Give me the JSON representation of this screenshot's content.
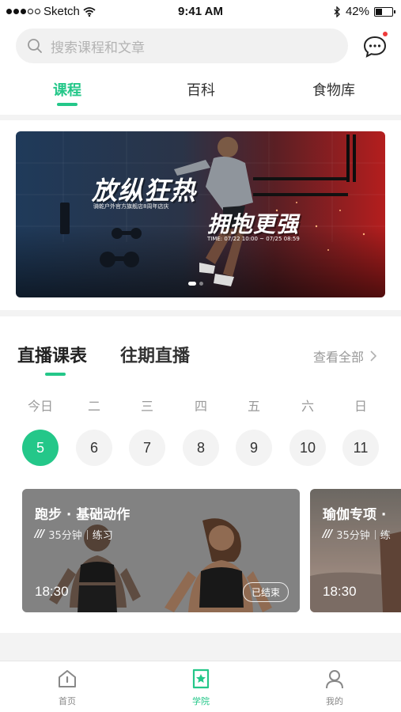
{
  "status_bar": {
    "carrier": "Sketch",
    "time": "9:41 AM",
    "battery": "42%",
    "battery_level": 0.42
  },
  "search": {
    "placeholder": "搜索课程和文章"
  },
  "header_tabs": [
    {
      "label": "课程",
      "active": true
    },
    {
      "label": "百科",
      "active": false
    },
    {
      "label": "食物库",
      "active": false
    }
  ],
  "banner": {
    "title_1": "放纵狂热",
    "subtitle": "骑乾户外官方旗舰店8周年店庆",
    "title_2": "拥抱更强",
    "time": "TIME: 07/22 10:00 ~ 07/25 08:59",
    "page_count": 2,
    "active_page": 1
  },
  "live": {
    "tab_schedule": "直播课表",
    "tab_past": "往期直播",
    "view_all": "查看全部",
    "weekdays": [
      "今日",
      "二",
      "三",
      "四",
      "五",
      "六",
      "日"
    ],
    "days": [
      "5",
      "6",
      "7",
      "8",
      "9",
      "10",
      "11"
    ],
    "active_day_index": 0,
    "courses": [
      {
        "title": "跑步 · 基础动作",
        "duration": "35分钟",
        "type": "练习",
        "time": "18:30",
        "status": "已结束"
      },
      {
        "title": "瑜伽专项 ·",
        "duration": "35分钟",
        "type": "练",
        "time": "18:30"
      }
    ]
  },
  "bottom_nav": [
    {
      "label": "首页",
      "icon": "home-icon",
      "active": false
    },
    {
      "label": "学院",
      "icon": "academy-icon",
      "active": true
    },
    {
      "label": "我的",
      "icon": "profile-icon",
      "active": false
    }
  ],
  "colors": {
    "accent": "#24c789",
    "badge": "#ee3b3b"
  }
}
